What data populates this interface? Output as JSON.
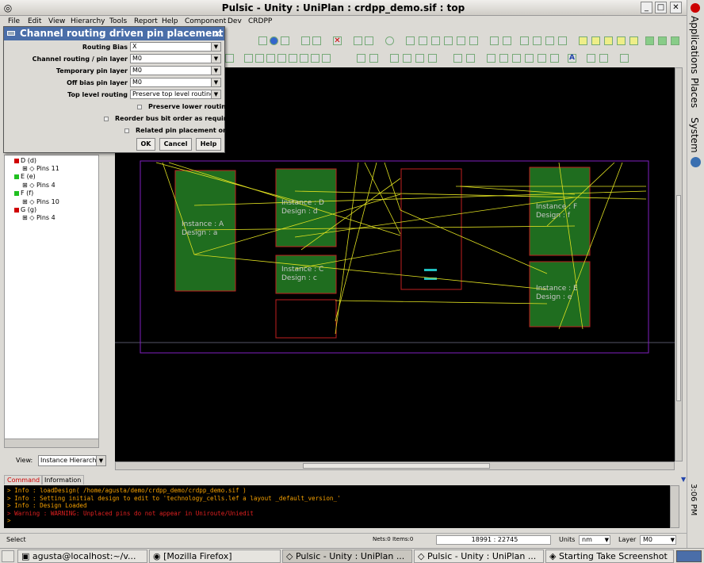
{
  "window": {
    "title": "Pulsic - Unity : UniPlan : crdpp_demo.sif : top"
  },
  "menubar": [
    "File",
    "Edit",
    "View",
    "Hierarchy",
    "Tools",
    "Report",
    "Help",
    "Component",
    "Dev",
    "CRDPP"
  ],
  "gnome_panel": {
    "applications": "Applications",
    "places": "Places",
    "system": "System",
    "clock": "3:06 PM"
  },
  "dialog": {
    "title": "Channel routing driven pin placement",
    "fields": [
      {
        "label": "Routing Bias",
        "value": "X"
      },
      {
        "label": "Channel routing / pin layer",
        "value": "M0"
      },
      {
        "label": "Temporary pin layer",
        "value": "M0"
      },
      {
        "label": "Off bias pin layer",
        "value": "M0"
      },
      {
        "label": "Top level routing",
        "value": "Preserve top level routing"
      }
    ],
    "checkboxes": [
      "Preserve lower routing",
      "Reorder bus bit order as required",
      "Related pin placement only"
    ],
    "buttons": {
      "ok": "OK",
      "cancel": "Cancel",
      "help": "Help"
    }
  },
  "tree": {
    "items": [
      {
        "label": "D (d)",
        "color": "#d00000"
      },
      {
        "label": "Pins 11"
      },
      {
        "label": "E (e)",
        "color": "#20c020"
      },
      {
        "label": "Pins 4"
      },
      {
        "label": "F (f)",
        "color": "#20c020"
      },
      {
        "label": "Pins 10"
      },
      {
        "label": "G (g)",
        "color": "#d00000"
      },
      {
        "label": "Pins 4"
      }
    ]
  },
  "view_selector": {
    "label": "View:",
    "value": "Instance Hierarch"
  },
  "layout": {
    "instances": [
      {
        "label": "Instance : A",
        "design": "Design : a"
      },
      {
        "label": "Instance : D",
        "design": "Design : d"
      },
      {
        "label": "Instance : C",
        "design": "Design : c"
      },
      {
        "label": "Instance : F",
        "design": "Design : f"
      },
      {
        "label": "Instance : E",
        "design": "Design : e"
      }
    ]
  },
  "console": {
    "tabs": {
      "command": "Command",
      "information": "Information"
    },
    "lines": [
      {
        "text": "> Info : loadDesign( /home/agusta/demo/crdpp_demo/crdpp_demo.sif )",
        "color": "#f5a000"
      },
      {
        "text": "> Info : Setting initial design to edit to 'technology_cells.lef a layout _default_version_'",
        "color": "#f5a000"
      },
      {
        "text": "> Info : Design Loaded",
        "color": "#f5a000"
      },
      {
        "text": "> Warning : WARNING: Unplaced pins do not appear in Uniroute/Uniedit",
        "color": "#e02020"
      },
      {
        "text": ">",
        "color": "#f5a000"
      }
    ]
  },
  "statusbar": {
    "mode": "Select",
    "nets": "Nets:0 Items:0",
    "coords": "18991 : 22745",
    "units_label": "Units",
    "units": "nm",
    "layer_label": "Layer",
    "layer": "M0"
  },
  "taskbar": [
    "agusta@localhost:~/v...",
    "[Mozilla Firefox]",
    "Pulsic - Unity : UniPlan ...",
    "Pulsic - Unity : UniPlan ...",
    "Starting Take Screenshot"
  ],
  "colors": {
    "canvas": "#000000",
    "instance_fill": "#1f6d1f",
    "boundary": "#8020c0",
    "wire": "#e0e020",
    "dialog_title": "#4a6ea9"
  }
}
